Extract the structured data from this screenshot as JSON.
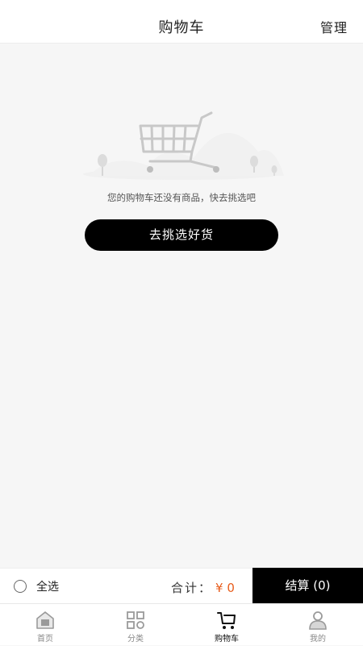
{
  "header": {
    "title": "购物车",
    "manage_label": "管理"
  },
  "empty_state": {
    "message": "您的购物车还没有商品，快去挑选吧",
    "button_label": "去挑选好货"
  },
  "checkout_bar": {
    "select_all_label": "全选",
    "total_label": "合计：",
    "total_amount": "¥ 0",
    "checkout_label": "结算 (0)",
    "accent_color": "#e85d1c"
  },
  "tabbar": {
    "active": "cart",
    "items": [
      {
        "label": "首页",
        "icon": "home-icon"
      },
      {
        "label": "分类",
        "icon": "category-icon"
      },
      {
        "label": "购物车",
        "icon": "cart-icon"
      },
      {
        "label": "我的",
        "icon": "profile-icon"
      }
    ]
  }
}
